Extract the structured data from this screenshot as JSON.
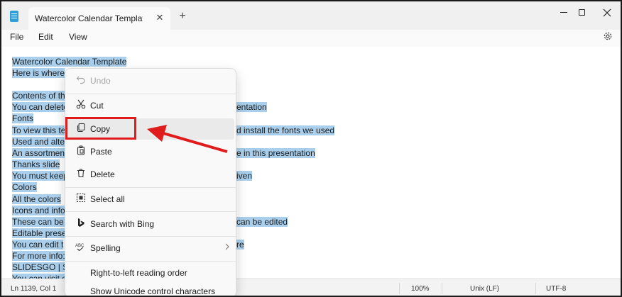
{
  "window": {
    "tab_title": "Watercolor Calendar Template by S",
    "tab_close": "✕",
    "new_tab": "+"
  },
  "menu": {
    "file": "File",
    "edit": "Edit",
    "view": "View"
  },
  "icons": {
    "settings": "gear-icon",
    "app": "notepad-icon"
  },
  "editor": {
    "lines": [
      "Watercolor Calendar Template",
      "Here is where",
      " ",
      "Contents of th",
      "You can delete",
      "Fonts",
      "To view this te",
      "Used and alte",
      "An assortment",
      "Thanks slide",
      "You must keep",
      "Colors",
      "All the colors",
      "Icons and info",
      "These can be u",
      "Editable prese",
      "You can edit t",
      "For more info:",
      "SLIDESGO | SL",
      "You can visit o"
    ],
    "right_fragments": [
      "entation",
      "d install the fonts we used",
      "e in this presentation",
      "iven",
      "can be edited",
      "re"
    ]
  },
  "context_menu": {
    "undo": "Undo",
    "cut": "Cut",
    "copy": "Copy",
    "paste": "Paste",
    "delete": "Delete",
    "select_all": "Select all",
    "search_bing": "Search with Bing",
    "spelling": "Spelling",
    "rtl": "Right-to-left reading order",
    "unicode": "Show Unicode control characters"
  },
  "status": {
    "position": "Ln 1139, Col 1",
    "zoom": "100%",
    "line_ending": "Unix (LF)",
    "encoding": "UTF-8"
  },
  "colors": {
    "selection": "#a9cfec",
    "highlight": "#e01b1b"
  }
}
